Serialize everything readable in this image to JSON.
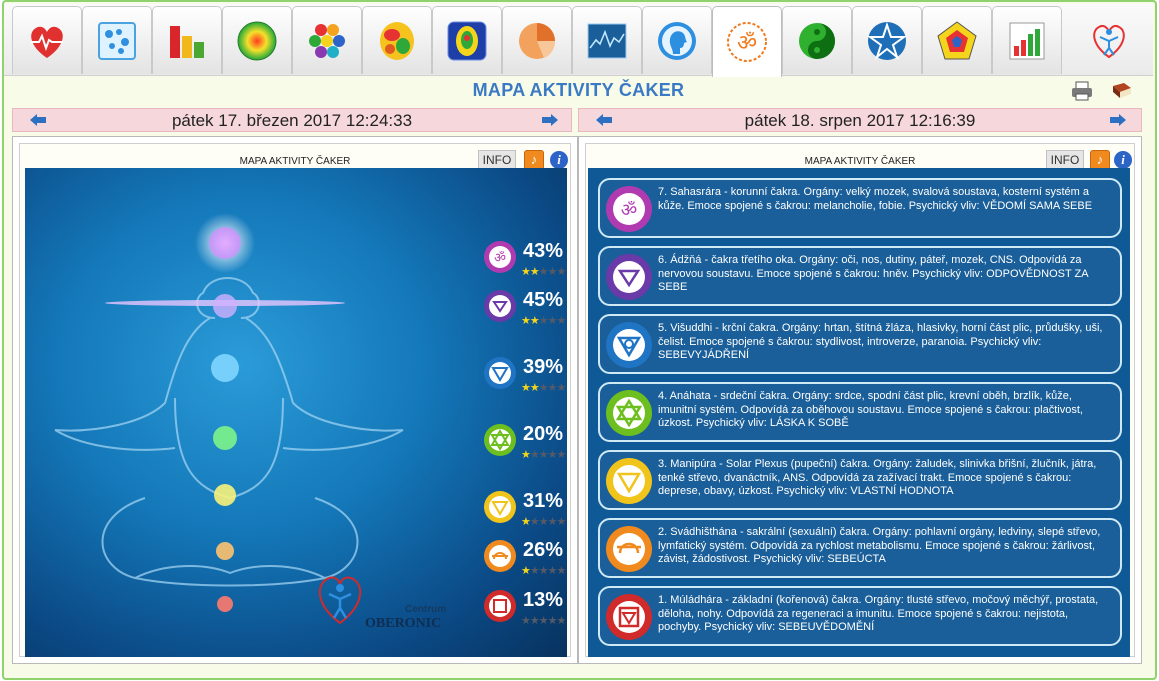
{
  "app": {
    "title": "MAPA AKTIVITY ČAKER",
    "tabs": [
      {
        "icon": "heart-pulse-icon"
      },
      {
        "icon": "grid-map-icon"
      },
      {
        "icon": "bar-chart-icon"
      },
      {
        "icon": "color-circle-icon"
      },
      {
        "icon": "hexagon-cluster-icon"
      },
      {
        "icon": "brain-map-icon"
      },
      {
        "icon": "organ-figure-icon"
      },
      {
        "icon": "pie-chart-icon"
      },
      {
        "icon": "line-graph-icon"
      },
      {
        "icon": "head-profile-icon"
      },
      {
        "icon": "om-icon",
        "active": true
      },
      {
        "icon": "yin-yang-icon"
      },
      {
        "icon": "pentagram-icon"
      },
      {
        "icon": "pentagon-radar-icon"
      },
      {
        "icon": "bar-graph-icon"
      },
      {
        "icon": "oberonic-logo-icon"
      }
    ]
  },
  "left": {
    "date": "pátek 17. březen 2017 12:24:33",
    "panel_title": "MAPA AKTIVITY ČAKER",
    "info_label": "INFO",
    "chakras": [
      {
        "pct": "43%",
        "stars": 2,
        "color": "#b03bb0"
      },
      {
        "pct": "45%",
        "stars": 2,
        "color": "#6a3aa8"
      },
      {
        "pct": "39%",
        "stars": 2,
        "color": "#1f74c4"
      },
      {
        "pct": "20%",
        "stars": 1,
        "color": "#6cbf1f"
      },
      {
        "pct": "31%",
        "stars": 1,
        "color": "#f0c41a"
      },
      {
        "pct": "26%",
        "stars": 1,
        "color": "#f08a1e"
      },
      {
        "pct": "13%",
        "stars": 0,
        "color": "#d12a2a"
      }
    ],
    "logo": {
      "top": "Centrum",
      "name": "OBERONIC"
    }
  },
  "right": {
    "date": "pátek 18. srpen 2017 12:16:39",
    "panel_title": "MAPA AKTIVITY ČAKER",
    "info_label": "INFO",
    "cards": [
      {
        "color": "#b03bb0",
        "text": "7. Sahasrára - korunní čakra. Orgány: velký mozek, svalová soustava, kosterní systém a kůže. Emoce spojené s čakrou: melancholie, fobie. Psychický vliv: VĚDOMÍ SAMA SEBE"
      },
      {
        "color": "#6a3aa8",
        "text": "6. Ádžňá - čakra třetího oka. Orgány: oči, nos, dutiny, páteř, mozek, CNS. Odpovídá za nervovou soustavu. Emoce spojené s čakrou: hněv. Psychický vliv: ODPOVĚDNOST ZA SEBE"
      },
      {
        "color": "#1f74c4",
        "text": "5. Višuddhi - krční čakra. Orgány: hrtan, štítná žláza, hlasivky, horní část plic, průdušky, uši, čelist. Emoce spojené s čakrou: stydlivost, introverze, paranoia. Psychický vliv: SEBEVYJÁDŘENÍ"
      },
      {
        "color": "#6cbf1f",
        "text": "4. Anáhata - srdeční čakra. Orgány: srdce, spodní část plic, krevní oběh, brzlík, kůže, imunitní systém. Odpovídá za oběhovou soustavu. Emoce spojené s čakrou: plačtivost, úzkost. Psychický vliv: LÁSKA K SOBĚ"
      },
      {
        "color": "#f0c41a",
        "text": "3. Manipúra - Solar Plexus (pupeční) čakra. Orgány: žaludek, slinivka břišní, žlučník, játra, tenké střevo, dvanáctník, ANS. Odpovídá za zažívací trakt. Emoce spojené s čakrou: deprese, obavy, úzkost. Psychický vliv: VLASTNÍ HODNOTA"
      },
      {
        "color": "#f08a1e",
        "text": "2. Svádhišthána - sakrální (sexuální) čakra. Orgány: pohlavní orgány, ledviny, slepé střevo, lymfatický systém. Odpovídá za rychlost metabolismu. Emoce spojené s čakrou: žárlivost, závist, žádostivost. Psychický vliv: SEBEÚCTA"
      },
      {
        "color": "#d12a2a",
        "text": "1. Múládhára - základní (kořenová) čakra. Orgány: tlusté střevo, močový měchýř, prostata, děloha, nohy. Odpovídá za regeneraci a imunitu. Emoce spojené s čakrou: nejistota, pochyby. Psychický vliv: SEBEUVĚDOMĚNÍ"
      }
    ]
  }
}
